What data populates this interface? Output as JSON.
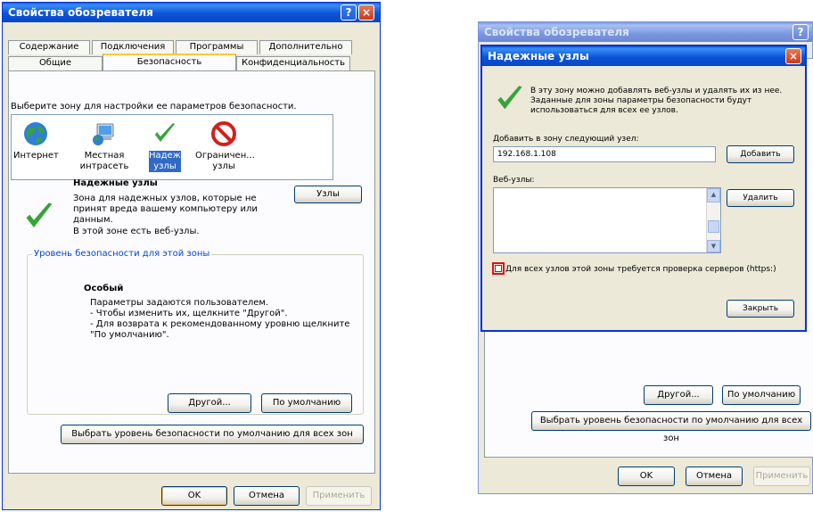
{
  "left_window": {
    "title": "Свойства обозревателя",
    "help_btn": "?",
    "close_btn": "×",
    "tabs_row1": [
      "Содержание",
      "Подключения",
      "Программы",
      "Дополнительно"
    ],
    "tabs_row2": [
      "Общие",
      "Безопасность",
      "Конфиденциальность"
    ],
    "zone_prompt": "Выберите зону для настройки ее параметров безопасности.",
    "zones": [
      {
        "label": "Интернет",
        "icon": "globe-icon"
      },
      {
        "label": "Местная интрасеть",
        "icon": "intranet-computer-icon"
      },
      {
        "label": "Надежные узлы",
        "icon": "checkmark-icon",
        "selected": true
      },
      {
        "label": "Ограничен... узлы",
        "icon": "restricted-icon"
      }
    ],
    "zone_title": "Надежные узлы",
    "zone_description": "Зона для надежных узлов, которые не принят вреда вашему компьютеру или данным.",
    "zone_has_sites": "В этой зоне есть веб-узлы.",
    "sites_btn": "Узлы",
    "security_level_group": "Уровень безопасности для этой зоны",
    "level_name": "Особый",
    "level_line1": "Параметры задаются пользователем.",
    "level_line2": "- Чтобы изменить их, щелкните \"Другой\".",
    "level_line3": "- Для возврата к рекомендованному уровню щелкните \"По умолчанию\".",
    "other_btn": "Другой...",
    "default_btn": "По умолчанию",
    "reset_all_btn": "Выбрать уровень безопасности по умолчанию для всех зон",
    "ok_btn": "OK",
    "cancel_btn": "Отмена",
    "apply_btn": "Применить"
  },
  "right_window": {
    "title": "Свойства обозревателя",
    "help_btn": "?",
    "other_btn": "Другой...",
    "default_btn": "По умолчанию",
    "reset_all_btn": "Выбрать уровень безопасности по умолчанию для всех зон",
    "ok_btn": "OK",
    "cancel_btn": "Отмена",
    "apply_btn": "Применить"
  },
  "dialog": {
    "title": "Надежные узлы",
    "close_btn": "×",
    "info_line1": "В эту зону можно добавлять веб-узлы и удалять их из нее.",
    "info_line2": "Заданные для зоны параметры безопасности будут",
    "info_line3": "использоваться для всех ее узлов.",
    "add_label": "Добавить в зону следующий узел:",
    "add_value": "192.168.1.108",
    "add_btn": "Добавить",
    "sites_label": "Веб-узлы:",
    "remove_btn": "Удалить",
    "https_checkbox": "Для всех узлов этой зоны требуется проверка серверов (https:)",
    "https_checked": false,
    "close_dialog_btn": "Закрыть"
  }
}
